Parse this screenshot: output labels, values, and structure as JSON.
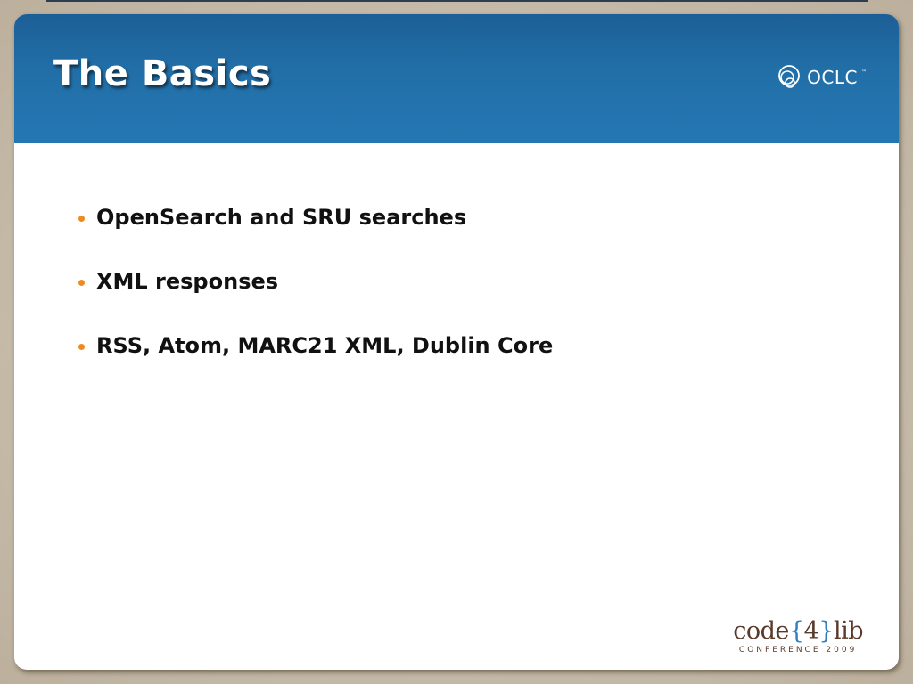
{
  "slide": {
    "title": "The Basics",
    "bullets": [
      "OpenSearch and SRU searches",
      "XML responses",
      "RSS, Atom, MARC21 XML, Dublin Core"
    ]
  },
  "logos": {
    "oclc": {
      "text": "OCLC",
      "trademark": "™",
      "icon": "oclc-rings-icon"
    },
    "code4lib": {
      "word_start": "code",
      "brace_open": "{",
      "number": "4",
      "brace_close": "}",
      "word_end": "lib",
      "subtitle": "CONFERENCE 2009"
    }
  },
  "colors": {
    "header_blue": "#226fa8",
    "bullet_orange": "#f08a1c",
    "body_text": "#111111",
    "frame_tan": "#c9bfae",
    "code4lib_brown": "#5a3a2a",
    "code4lib_blue": "#2f7fbf"
  }
}
